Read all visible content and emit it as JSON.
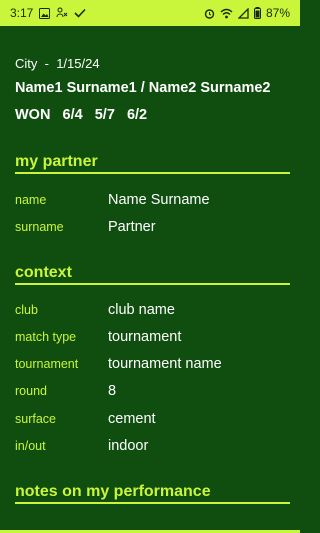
{
  "status_bar": {
    "time": "3:17",
    "battery": "87%",
    "icons_left": [
      "image-icon",
      "missed-call-icon",
      "check-icon"
    ],
    "icons_right": [
      "alarm-icon",
      "wifi-icon",
      "signal-icon",
      "battery-icon"
    ]
  },
  "match": {
    "city": "City",
    "separator": "-",
    "date": "1/15/24",
    "players": "Name1 Surname1 / Name2 Surname2",
    "result": "WON",
    "scores": [
      "6/4",
      "5/7",
      "6/2"
    ]
  },
  "partner": {
    "title": "my partner",
    "fields": [
      {
        "label": "name",
        "value": "Name Surname"
      },
      {
        "label": "surname",
        "value": "Partner"
      }
    ]
  },
  "context": {
    "title": "context",
    "fields": [
      {
        "label": "club",
        "value": "club name"
      },
      {
        "label": "match type",
        "value": "tournament"
      },
      {
        "label": "tournament",
        "value": "tournament name"
      },
      {
        "label": "round",
        "value": "8"
      },
      {
        "label": "surface",
        "value": "cement"
      },
      {
        "label": "in/out",
        "value": "indoor"
      }
    ]
  },
  "notes": {
    "title": "notes on my performance"
  },
  "colors": {
    "background": "#0f4e0f",
    "accent": "#c9f53a",
    "text": "#ffffff"
  }
}
